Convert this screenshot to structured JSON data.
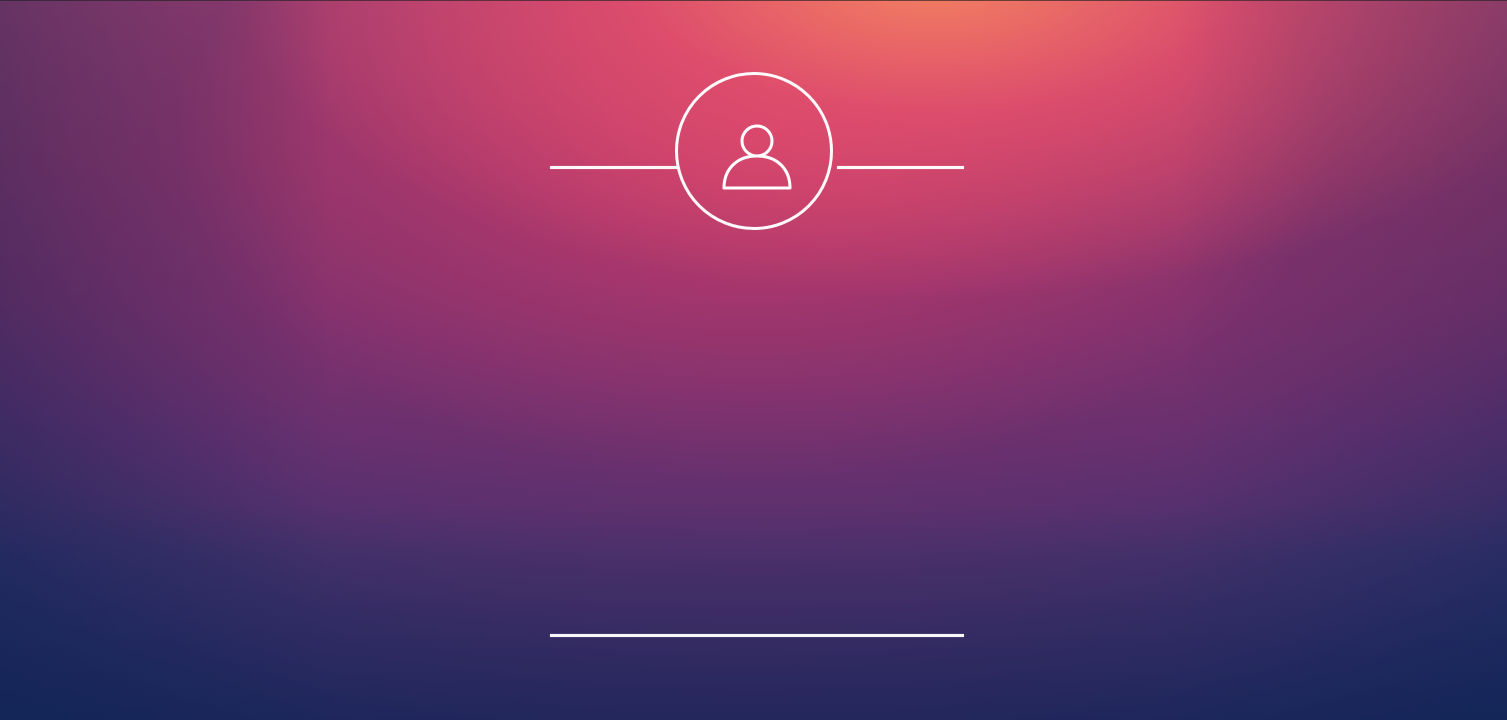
{
  "screen": {
    "colors": {
      "top": "#f58362",
      "middle": "#b83d6b",
      "lower": "#553173",
      "bottom": "#182a5f",
      "line": "#ffffff"
    }
  },
  "avatar": {
    "icon": "user-icon"
  },
  "input": {
    "value": ""
  }
}
